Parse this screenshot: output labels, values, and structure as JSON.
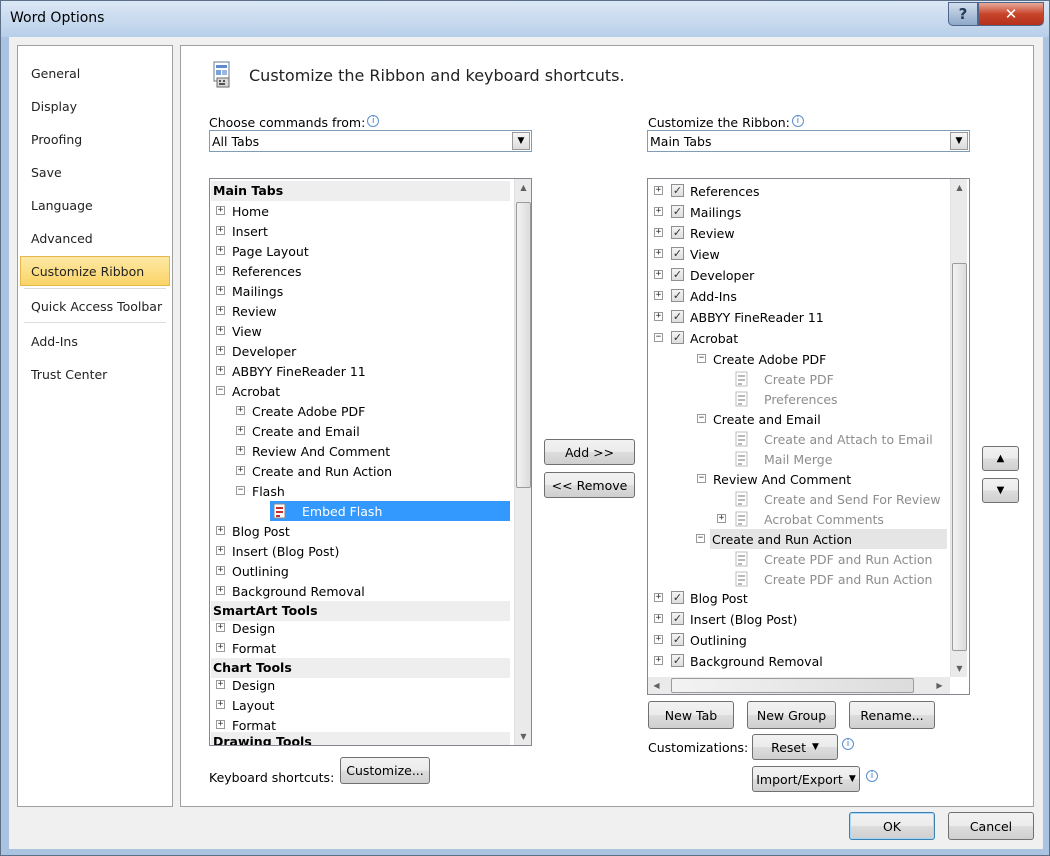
{
  "window": {
    "title": "Word Options",
    "help_label": "?",
    "close_label": "✕"
  },
  "sidebar": {
    "items": [
      {
        "label": "General"
      },
      {
        "label": "Display"
      },
      {
        "label": "Proofing"
      },
      {
        "label": "Save"
      },
      {
        "label": "Language"
      },
      {
        "label": "Advanced"
      },
      {
        "label": "Customize Ribbon"
      },
      {
        "label": "Quick Access Toolbar"
      },
      {
        "label": "Add-Ins"
      },
      {
        "label": "Trust Center"
      }
    ],
    "selected": "Customize Ribbon"
  },
  "header": {
    "title": "Customize the Ribbon and keyboard shortcuts."
  },
  "left": {
    "label": "Choose commands from:",
    "combo_value": "All Tabs",
    "rows": [
      {
        "kind": "header",
        "text": "Main Tabs"
      },
      {
        "kind": "item",
        "text": "Home",
        "level": 0,
        "exp": "+"
      },
      {
        "kind": "item",
        "text": "Insert",
        "level": 0,
        "exp": "+"
      },
      {
        "kind": "item",
        "text": "Page Layout",
        "level": 0,
        "exp": "+"
      },
      {
        "kind": "item",
        "text": "References",
        "level": 0,
        "exp": "+"
      },
      {
        "kind": "item",
        "text": "Mailings",
        "level": 0,
        "exp": "+"
      },
      {
        "kind": "item",
        "text": "Review",
        "level": 0,
        "exp": "+"
      },
      {
        "kind": "item",
        "text": "View",
        "level": 0,
        "exp": "+"
      },
      {
        "kind": "item",
        "text": "Developer",
        "level": 0,
        "exp": "+"
      },
      {
        "kind": "item",
        "text": "ABBYY FineReader 11",
        "level": 0,
        "exp": "+"
      },
      {
        "kind": "item",
        "text": "Acrobat",
        "level": 0,
        "exp": "−"
      },
      {
        "kind": "item",
        "text": "Create Adobe PDF",
        "level": 1,
        "exp": "+"
      },
      {
        "kind": "item",
        "text": "Create and Email",
        "level": 1,
        "exp": "+"
      },
      {
        "kind": "item",
        "text": "Review And Comment",
        "level": 1,
        "exp": "+"
      },
      {
        "kind": "item",
        "text": "Create and Run Action",
        "level": 1,
        "exp": "+"
      },
      {
        "kind": "item",
        "text": "Flash",
        "level": 1,
        "exp": "−"
      },
      {
        "kind": "cmd",
        "text": "Embed Flash",
        "level": 2,
        "selected": true
      },
      {
        "kind": "item",
        "text": "Blog Post",
        "level": 0,
        "exp": "+"
      },
      {
        "kind": "item",
        "text": "Insert (Blog Post)",
        "level": 0,
        "exp": "+"
      },
      {
        "kind": "item",
        "text": "Outlining",
        "level": 0,
        "exp": "+"
      },
      {
        "kind": "item",
        "text": "Background Removal",
        "level": 0,
        "exp": "+"
      },
      {
        "kind": "header",
        "text": "SmartArt Tools"
      },
      {
        "kind": "item",
        "text": "Design",
        "level": 0,
        "exp": "+"
      },
      {
        "kind": "item",
        "text": "Format",
        "level": 0,
        "exp": "+"
      },
      {
        "kind": "header",
        "text": "Chart Tools"
      },
      {
        "kind": "item",
        "text": "Design",
        "level": 0,
        "exp": "+"
      },
      {
        "kind": "item",
        "text": "Layout",
        "level": 0,
        "exp": "+"
      },
      {
        "kind": "item",
        "text": "Format",
        "level": 0,
        "exp": "+"
      },
      {
        "kind": "header",
        "text": "Drawing Tools"
      }
    ],
    "keyboard_label": "Keyboard shortcuts:",
    "customize_button": "Customize..."
  },
  "middle": {
    "add_button": "Add >>",
    "remove_button": "<< Remove"
  },
  "right": {
    "label": "Customize the Ribbon:",
    "combo_value": "Main Tabs",
    "rows": [
      {
        "kind": "tab",
        "text": "References",
        "exp": "+"
      },
      {
        "kind": "tab",
        "text": "Mailings",
        "exp": "+"
      },
      {
        "kind": "tab",
        "text": "Review",
        "exp": "+"
      },
      {
        "kind": "tab",
        "text": "View",
        "exp": "+"
      },
      {
        "kind": "tab",
        "text": "Developer",
        "exp": "+"
      },
      {
        "kind": "tab",
        "text": "Add-Ins",
        "exp": "+"
      },
      {
        "kind": "tab",
        "text": "ABBYY FineReader 11",
        "exp": "+"
      },
      {
        "kind": "tab",
        "text": "Acrobat",
        "exp": "−"
      },
      {
        "kind": "group",
        "text": "Create Adobe PDF",
        "exp": "−"
      },
      {
        "kind": "cmd",
        "text": "Create PDF"
      },
      {
        "kind": "cmd",
        "text": "Preferences"
      },
      {
        "kind": "group",
        "text": "Create and Email",
        "exp": "−"
      },
      {
        "kind": "cmd",
        "text": "Create and Attach to Email"
      },
      {
        "kind": "cmd",
        "text": "Mail Merge"
      },
      {
        "kind": "group",
        "text": "Review And Comment",
        "exp": "−"
      },
      {
        "kind": "cmd",
        "text": "Create and Send For Review"
      },
      {
        "kind": "cmd",
        "text": "Acrobat Comments",
        "exp": "+"
      },
      {
        "kind": "group",
        "text": "Create and Run Action",
        "exp": "−",
        "highlight": true
      },
      {
        "kind": "cmd",
        "text": "Create PDF and Run Action"
      },
      {
        "kind": "cmd",
        "text": "Create PDF and Run Action"
      },
      {
        "kind": "tab",
        "text": "Blog Post",
        "exp": "+"
      },
      {
        "kind": "tab",
        "text": "Insert (Blog Post)",
        "exp": "+"
      },
      {
        "kind": "tab",
        "text": "Outlining",
        "exp": "+"
      },
      {
        "kind": "tab",
        "text": "Background Removal",
        "exp": "+"
      }
    ],
    "new_tab_button": "New Tab",
    "new_group_button": "New Group",
    "rename_button": "Rename...",
    "customizations_label": "Customizations:",
    "reset_button": "Reset",
    "import_export_button": "Import/Export"
  },
  "footer": {
    "ok_button": "OK",
    "cancel_button": "Cancel"
  },
  "colors": {
    "selection": "#3399ff",
    "nav_selected": "#fbd467",
    "titlebar": "#b8cfe9"
  }
}
